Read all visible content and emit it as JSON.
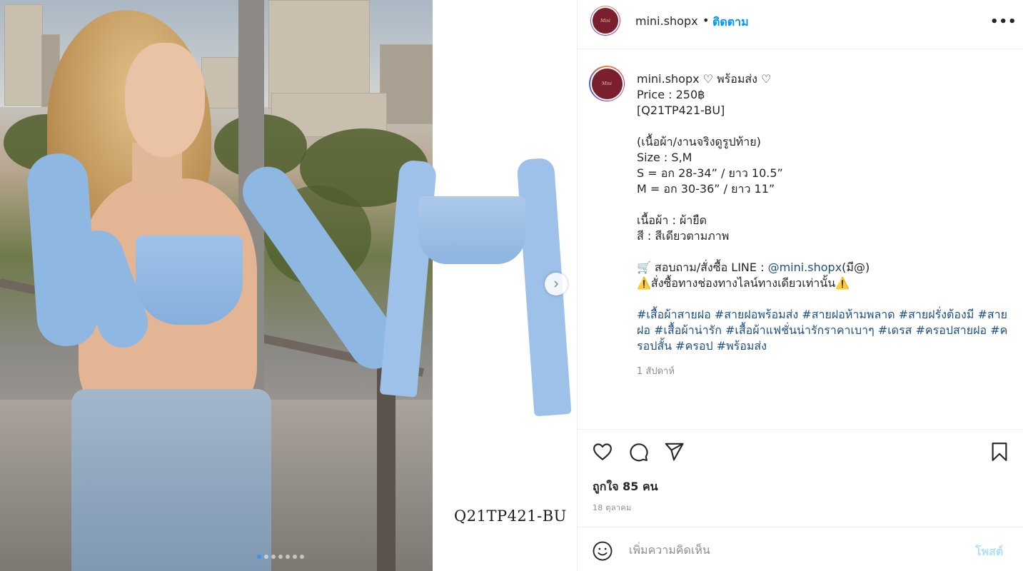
{
  "header": {
    "username": "mini.shopx",
    "separator": "•",
    "follow_label": "ติดตาม",
    "more_label": "•••"
  },
  "media": {
    "product_code": "Q21TP421-BU",
    "slide_count": 7,
    "active_slide": 1
  },
  "caption": {
    "username": "mini.shopx",
    "title": "♡ พร้อมส่ง ♡",
    "lines": [
      "Price : 250฿",
      "[Q21TP421-BU]",
      "",
      "(เนื้อผ้า/งานจริงดูรูปท้าย)",
      "Size : S,M",
      "S = อก 28-34” / ยาว 10.5”",
      "M = อก 30-36” / ยาว 11”",
      "",
      "เนื้อผ้า : ผ้ายืด",
      "สี : สีเดียวตามภาพ",
      ""
    ],
    "contact_prefix": "🛒 สอบถาม/สั่งซื้อ LINE : ",
    "contact_link": "@mini.shopx",
    "contact_suffix": "(มี@)",
    "warning": "⚠️สั่งซื้อทางช่องทางไลน์ทางเดียวเท่านั้น⚠️",
    "hashtags": [
      "#เสื้อผ้าสายฝอ",
      "#สายฝอพร้อมส่ง",
      "#สายฝอห้ามพลาด",
      "#สายฝรั่งต้องมี",
      "#สายฝอ",
      "#เสื้อผ้าน่ารัก",
      "#เสื้อผ้าแฟชั่นน่ารักราคาเบาๆ",
      "#เดรส",
      "#ครอปสายฝอ",
      "#ครอปสั้น",
      "#ครอป",
      "#พร้อมส่ง"
    ],
    "time_ago": "1 สัปดาห์"
  },
  "actions": {
    "likes_text": "ถูกใจ 85 คน",
    "date_text": "18 ตุลาคม"
  },
  "comment": {
    "placeholder": "เพิ่มความคิดเห็น",
    "post_label": "โพสต์"
  },
  "colors": {
    "accent": "#0095f6",
    "link": "#1d4f8a",
    "muted": "#8e8e8e",
    "post_disabled": "#b2dffc"
  }
}
